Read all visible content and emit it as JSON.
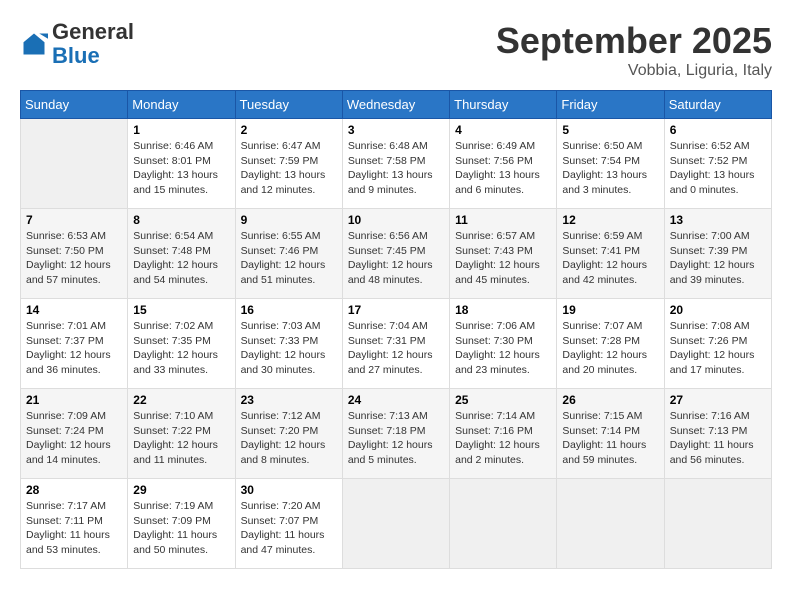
{
  "header": {
    "logo_general": "General",
    "logo_blue": "Blue",
    "title": "September 2025",
    "location": "Vobbia, Liguria, Italy"
  },
  "days_of_week": [
    "Sunday",
    "Monday",
    "Tuesday",
    "Wednesday",
    "Thursday",
    "Friday",
    "Saturday"
  ],
  "weeks": [
    [
      {
        "day": "",
        "empty": true
      },
      {
        "day": "1",
        "sunrise": "Sunrise: 6:46 AM",
        "sunset": "Sunset: 8:01 PM",
        "daylight": "Daylight: 13 hours and 15 minutes."
      },
      {
        "day": "2",
        "sunrise": "Sunrise: 6:47 AM",
        "sunset": "Sunset: 7:59 PM",
        "daylight": "Daylight: 13 hours and 12 minutes."
      },
      {
        "day": "3",
        "sunrise": "Sunrise: 6:48 AM",
        "sunset": "Sunset: 7:58 PM",
        "daylight": "Daylight: 13 hours and 9 minutes."
      },
      {
        "day": "4",
        "sunrise": "Sunrise: 6:49 AM",
        "sunset": "Sunset: 7:56 PM",
        "daylight": "Daylight: 13 hours and 6 minutes."
      },
      {
        "day": "5",
        "sunrise": "Sunrise: 6:50 AM",
        "sunset": "Sunset: 7:54 PM",
        "daylight": "Daylight: 13 hours and 3 minutes."
      },
      {
        "day": "6",
        "sunrise": "Sunrise: 6:52 AM",
        "sunset": "Sunset: 7:52 PM",
        "daylight": "Daylight: 13 hours and 0 minutes."
      }
    ],
    [
      {
        "day": "7",
        "sunrise": "Sunrise: 6:53 AM",
        "sunset": "Sunset: 7:50 PM",
        "daylight": "Daylight: 12 hours and 57 minutes."
      },
      {
        "day": "8",
        "sunrise": "Sunrise: 6:54 AM",
        "sunset": "Sunset: 7:48 PM",
        "daylight": "Daylight: 12 hours and 54 minutes."
      },
      {
        "day": "9",
        "sunrise": "Sunrise: 6:55 AM",
        "sunset": "Sunset: 7:46 PM",
        "daylight": "Daylight: 12 hours and 51 minutes."
      },
      {
        "day": "10",
        "sunrise": "Sunrise: 6:56 AM",
        "sunset": "Sunset: 7:45 PM",
        "daylight": "Daylight: 12 hours and 48 minutes."
      },
      {
        "day": "11",
        "sunrise": "Sunrise: 6:57 AM",
        "sunset": "Sunset: 7:43 PM",
        "daylight": "Daylight: 12 hours and 45 minutes."
      },
      {
        "day": "12",
        "sunrise": "Sunrise: 6:59 AM",
        "sunset": "Sunset: 7:41 PM",
        "daylight": "Daylight: 12 hours and 42 minutes."
      },
      {
        "day": "13",
        "sunrise": "Sunrise: 7:00 AM",
        "sunset": "Sunset: 7:39 PM",
        "daylight": "Daylight: 12 hours and 39 minutes."
      }
    ],
    [
      {
        "day": "14",
        "sunrise": "Sunrise: 7:01 AM",
        "sunset": "Sunset: 7:37 PM",
        "daylight": "Daylight: 12 hours and 36 minutes."
      },
      {
        "day": "15",
        "sunrise": "Sunrise: 7:02 AM",
        "sunset": "Sunset: 7:35 PM",
        "daylight": "Daylight: 12 hours and 33 minutes."
      },
      {
        "day": "16",
        "sunrise": "Sunrise: 7:03 AM",
        "sunset": "Sunset: 7:33 PM",
        "daylight": "Daylight: 12 hours and 30 minutes."
      },
      {
        "day": "17",
        "sunrise": "Sunrise: 7:04 AM",
        "sunset": "Sunset: 7:31 PM",
        "daylight": "Daylight: 12 hours and 27 minutes."
      },
      {
        "day": "18",
        "sunrise": "Sunrise: 7:06 AM",
        "sunset": "Sunset: 7:30 PM",
        "daylight": "Daylight: 12 hours and 23 minutes."
      },
      {
        "day": "19",
        "sunrise": "Sunrise: 7:07 AM",
        "sunset": "Sunset: 7:28 PM",
        "daylight": "Daylight: 12 hours and 20 minutes."
      },
      {
        "day": "20",
        "sunrise": "Sunrise: 7:08 AM",
        "sunset": "Sunset: 7:26 PM",
        "daylight": "Daylight: 12 hours and 17 minutes."
      }
    ],
    [
      {
        "day": "21",
        "sunrise": "Sunrise: 7:09 AM",
        "sunset": "Sunset: 7:24 PM",
        "daylight": "Daylight: 12 hours and 14 minutes."
      },
      {
        "day": "22",
        "sunrise": "Sunrise: 7:10 AM",
        "sunset": "Sunset: 7:22 PM",
        "daylight": "Daylight: 12 hours and 11 minutes."
      },
      {
        "day": "23",
        "sunrise": "Sunrise: 7:12 AM",
        "sunset": "Sunset: 7:20 PM",
        "daylight": "Daylight: 12 hours and 8 minutes."
      },
      {
        "day": "24",
        "sunrise": "Sunrise: 7:13 AM",
        "sunset": "Sunset: 7:18 PM",
        "daylight": "Daylight: 12 hours and 5 minutes."
      },
      {
        "day": "25",
        "sunrise": "Sunrise: 7:14 AM",
        "sunset": "Sunset: 7:16 PM",
        "daylight": "Daylight: 12 hours and 2 minutes."
      },
      {
        "day": "26",
        "sunrise": "Sunrise: 7:15 AM",
        "sunset": "Sunset: 7:14 PM",
        "daylight": "Daylight: 11 hours and 59 minutes."
      },
      {
        "day": "27",
        "sunrise": "Sunrise: 7:16 AM",
        "sunset": "Sunset: 7:13 PM",
        "daylight": "Daylight: 11 hours and 56 minutes."
      }
    ],
    [
      {
        "day": "28",
        "sunrise": "Sunrise: 7:17 AM",
        "sunset": "Sunset: 7:11 PM",
        "daylight": "Daylight: 11 hours and 53 minutes."
      },
      {
        "day": "29",
        "sunrise": "Sunrise: 7:19 AM",
        "sunset": "Sunset: 7:09 PM",
        "daylight": "Daylight: 11 hours and 50 minutes."
      },
      {
        "day": "30",
        "sunrise": "Sunrise: 7:20 AM",
        "sunset": "Sunset: 7:07 PM",
        "daylight": "Daylight: 11 hours and 47 minutes."
      },
      {
        "day": "",
        "empty": true
      },
      {
        "day": "",
        "empty": true
      },
      {
        "day": "",
        "empty": true
      },
      {
        "day": "",
        "empty": true
      }
    ]
  ]
}
